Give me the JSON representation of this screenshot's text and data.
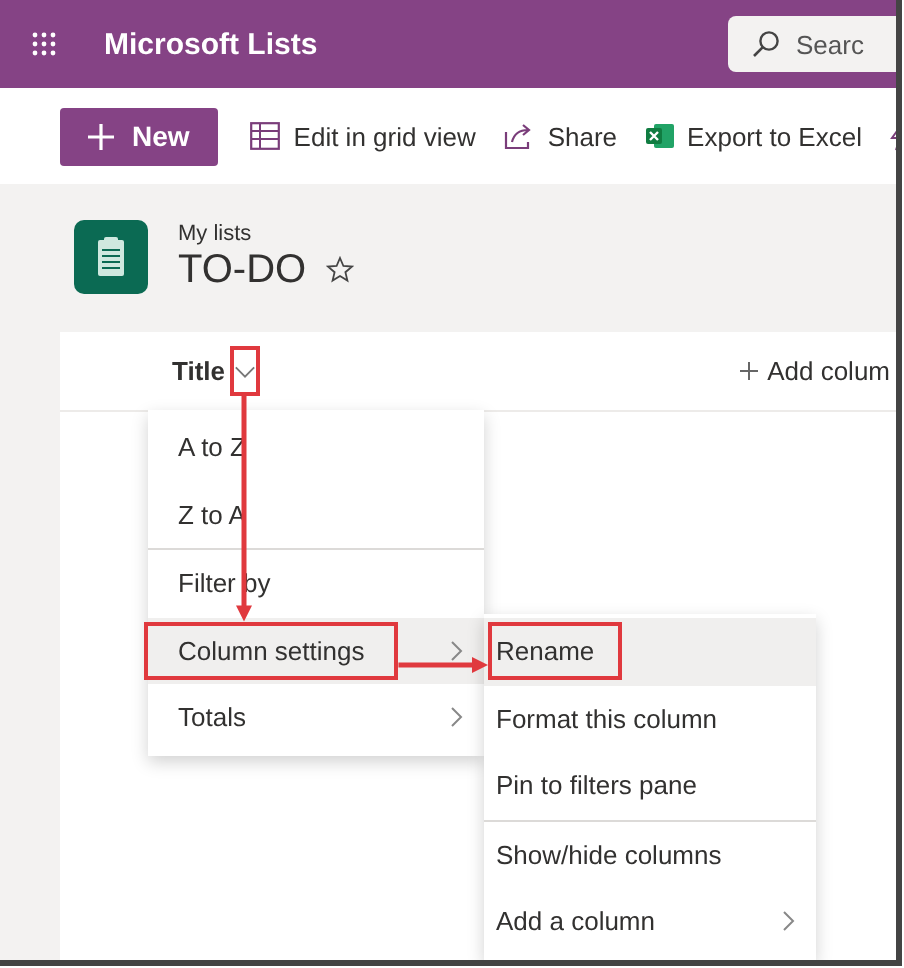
{
  "app": {
    "title": "Microsoft Lists",
    "search": {
      "placeholder": "Searc"
    }
  },
  "toolbar": {
    "new_button": "New",
    "actions": [
      {
        "kind": "grid",
        "label": "Edit in grid view"
      },
      {
        "kind": "share",
        "label": "Share"
      },
      {
        "kind": "excel",
        "label": "Export to Excel"
      },
      {
        "kind": "flow"
      }
    ]
  },
  "list": {
    "breadcrumb": "My lists",
    "title": "TO-DO",
    "favorite": false
  },
  "columns": [
    {
      "label": "Title",
      "menu_open": true,
      "highlighted": true
    }
  ],
  "add_column": "Add colum",
  "column_menu": {
    "items": [
      {
        "label": "A to Z",
        "divider_before": false,
        "submenu": false,
        "hovered": false,
        "highlighted": false
      },
      {
        "label": "Z to A",
        "divider_before": false,
        "submenu": false,
        "hovered": false,
        "highlighted": false
      },
      {
        "label": "Filter by",
        "divider_before": true,
        "submenu": false,
        "hovered": false,
        "highlighted": false
      },
      {
        "label": "Column settings",
        "divider_before": false,
        "submenu": true,
        "hovered": true,
        "highlighted": true
      },
      {
        "label": "Totals",
        "divider_before": false,
        "submenu": true,
        "hovered": false,
        "highlighted": false
      }
    ]
  },
  "submenu": {
    "items": [
      {
        "label": "Rename",
        "divider_before": false,
        "submenu": false,
        "hovered": true,
        "highlighted": true
      },
      {
        "label": "Format this column",
        "divider_before": false,
        "submenu": false,
        "hovered": false,
        "highlighted": false
      },
      {
        "label": "Pin to filters pane",
        "divider_before": false,
        "submenu": false,
        "hovered": false,
        "highlighted": false
      },
      {
        "label": "Show/hide columns",
        "divider_before": true,
        "submenu": false,
        "hovered": false,
        "highlighted": false
      },
      {
        "label": "Add a column",
        "divider_before": false,
        "submenu": true,
        "hovered": false,
        "highlighted": false
      }
    ]
  }
}
